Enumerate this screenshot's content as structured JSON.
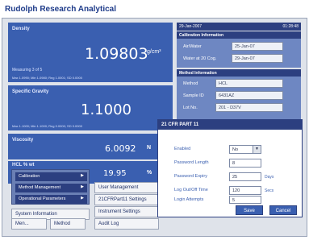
{
  "app": {
    "title": "Rudolph Research Analytical"
  },
  "density": {
    "label": "Density",
    "value": "1.09803",
    "unit": "g/cm³",
    "measuring": "Measuring  3 of 5",
    "stats": "Max 1.0990; Min 1.0980; Rng 1.0001; SD 0.0000"
  },
  "specific_gravity": {
    "label": "Specific Gravity",
    "value": "1.1000",
    "stats": "Max 1.1000; Min 1.1000; Rng 0.0000; SD 0.0000"
  },
  "viscosity": {
    "label": "Viscosity",
    "value": "6.0092",
    "unit": "N"
  },
  "hcl": {
    "label": "HCL % wt",
    "value": "19.95",
    "unit": "%"
  },
  "info": {
    "date": "29-Jan-2007",
    "time": "01:28:48",
    "calibration_title": "Calibration Information",
    "calibration_rows": [
      {
        "label": "Air/Water",
        "value": "25-Jan-07"
      },
      {
        "label": "Water at 20 Cog.",
        "value": "29-Jan-07"
      }
    ],
    "method_title": "Method Information",
    "method_rows": [
      {
        "label": "Method",
        "value": "HCL"
      },
      {
        "label": "Sample ID",
        "value": "6431AZ"
      },
      {
        "label": "Lot No.",
        "value": "201 - D37V"
      }
    ]
  },
  "popup_menu": {
    "items": [
      {
        "label": "Calibration",
        "arrow": "▶"
      },
      {
        "label": "Method Management",
        "arrow": "▶"
      },
      {
        "label": "Operational Parameters",
        "arrow": "▶"
      }
    ]
  },
  "menu_buttons": {
    "system_information": "System Information",
    "menu": "Men...",
    "method": "Method",
    "user_management": "User Management",
    "cfr_settings": "21CFRPart11 Settings",
    "instrument_settings": "Instrument Settings",
    "audit_log": "Audit Log"
  },
  "dialog": {
    "title": "21 CFR PART 11",
    "rows": [
      {
        "label": "Enabled",
        "value": "No",
        "unit": ""
      },
      {
        "label": "Password Length",
        "value": "8",
        "unit": ""
      },
      {
        "label": "Password Expiry",
        "value": "25",
        "unit": "Days"
      },
      {
        "label": "Log Out/Off Time",
        "value": "120",
        "unit": "Secs"
      },
      {
        "label": "Login Attempts",
        "value": "5",
        "unit": ""
      }
    ],
    "select_arrow": "▼",
    "save": "Save",
    "cancel": "Cancel"
  }
}
